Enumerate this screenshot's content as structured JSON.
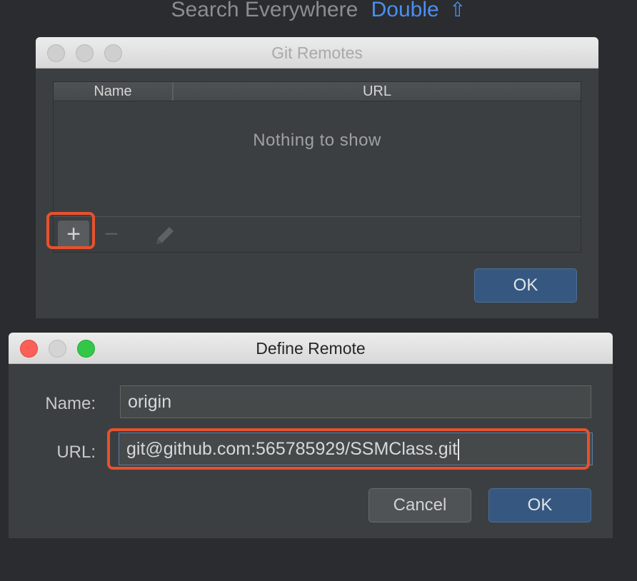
{
  "hint": {
    "label": "Search Everywhere",
    "action": "Double",
    "shift_glyph": "⇧"
  },
  "git_remotes": {
    "title": "Git Remotes",
    "columns": [
      "Name",
      "URL"
    ],
    "empty_text": "Nothing to show",
    "toolbar": {
      "add": "+",
      "remove": "−",
      "edit_icon": "pencil-icon"
    },
    "ok_label": "OK"
  },
  "define_remote": {
    "title": "Define Remote",
    "name_label": "Name:",
    "name_value": "origin",
    "url_label": "URL:",
    "url_value": "git@github.com:565785929/SSMClass.git",
    "cancel_label": "Cancel",
    "ok_label": "OK"
  },
  "colors": {
    "accent": "#365880",
    "highlight": "#e8512d",
    "link": "#4a8ff0"
  }
}
